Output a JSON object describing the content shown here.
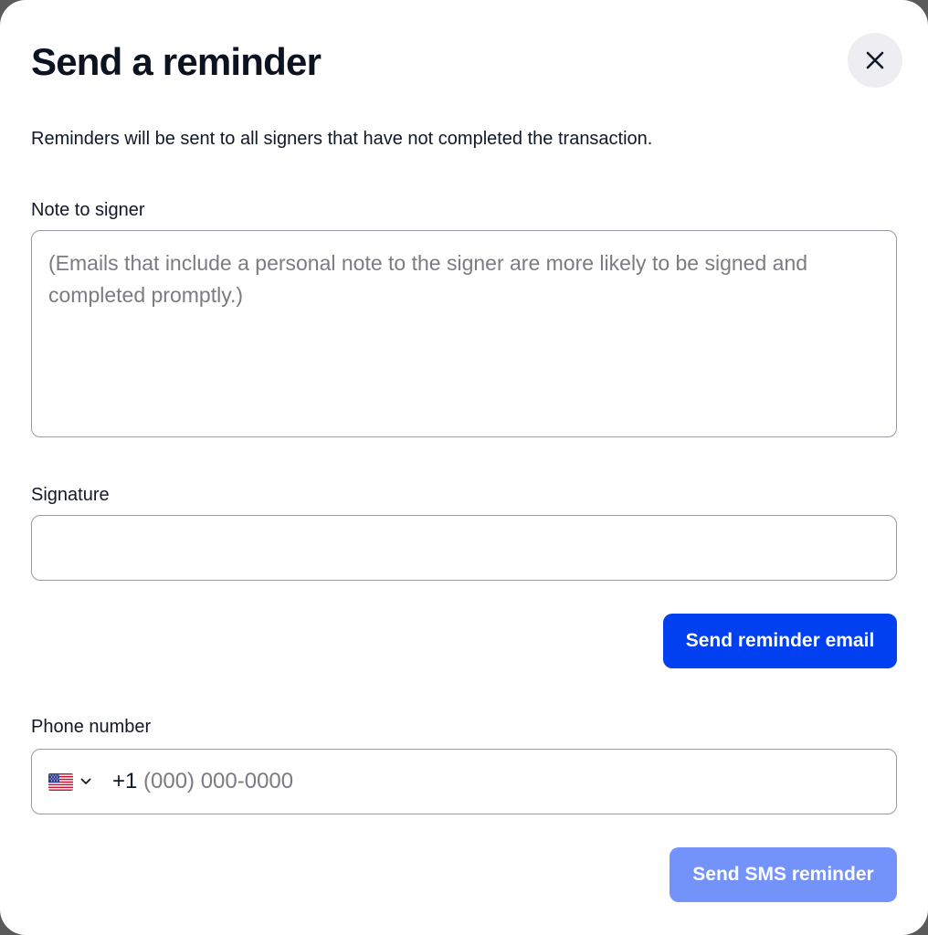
{
  "dialog": {
    "title": "Send a reminder",
    "description": "Reminders will be sent to all signers that have not completed the transaction."
  },
  "note": {
    "label": "Note to signer",
    "value": "",
    "placeholder": "(Emails that include a personal note to the signer are more likely to be signed and completed promptly.)"
  },
  "signature": {
    "label": "Signature",
    "value": "",
    "placeholder": ""
  },
  "email_button": {
    "label": "Send reminder email"
  },
  "phone": {
    "label": "Phone number",
    "country_icon": "us-flag-icon",
    "dial_code": "+1",
    "value": "",
    "placeholder": "(000) 000-0000"
  },
  "sms_button": {
    "label": "Send SMS reminder"
  },
  "icons": {
    "close": "close-icon",
    "chevron": "chevron-down-icon"
  },
  "colors": {
    "primary": "#0040f0",
    "primary_disabled": "#7393fb",
    "close_bg": "#eeeef2",
    "text": "#111827",
    "placeholder": "#7a7c82",
    "border": "#9a9ca3"
  }
}
